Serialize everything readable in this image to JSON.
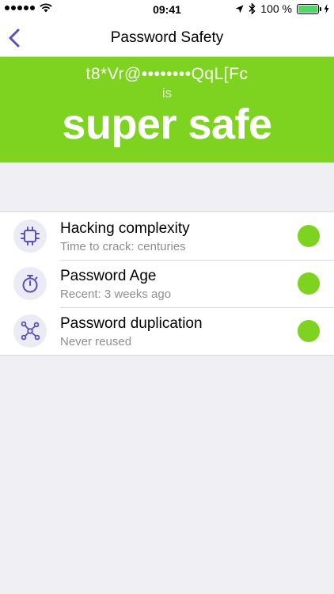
{
  "status_bar": {
    "carrier_signal": "●●●●●",
    "time": "09:41",
    "battery_percent": "100 %",
    "icons": [
      "wifi-icon",
      "location-icon",
      "bluetooth-icon",
      "battery-icon",
      "charging-icon"
    ]
  },
  "nav": {
    "title": "Password Safety",
    "back_icon": "chevron-left-icon"
  },
  "hero": {
    "password_masked": "t8*Vr@••••••••QqL[Fc",
    "connector": "is",
    "rating": "super safe",
    "color": "#7ed321"
  },
  "checks": [
    {
      "icon": "chip-icon",
      "title": "Hacking complexity",
      "subtitle": "Time to crack: centuries",
      "status_color": "#7ed321"
    },
    {
      "icon": "stopwatch-icon",
      "title": "Password Age",
      "subtitle": "Recent: 3 weeks ago",
      "status_color": "#7ed321"
    },
    {
      "icon": "network-icon",
      "title": "Password duplication",
      "subtitle": "Never reused",
      "status_color": "#7ed321"
    }
  ],
  "colors": {
    "accent": "#5b50b5",
    "safe_green": "#7ed321",
    "background": "#efeff4"
  }
}
